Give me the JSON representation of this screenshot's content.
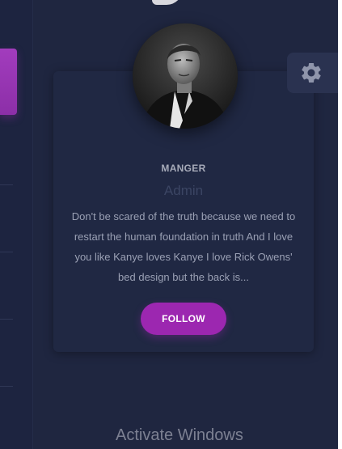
{
  "profile_card": {
    "role": "MANGER",
    "name": "Admin",
    "description": "Don't be scared of the truth because we need to restart the human foundation in truth And I love you like Kanye loves Kanye I love Rick Owens' bed design but the back is...",
    "follow_label": "FOLLOW"
  },
  "settings": {
    "icon": "gear-icon"
  },
  "watermark": {
    "text": "Activate Windows"
  },
  "colors": {
    "background": "#1f2640",
    "card": "#202843",
    "accent": "#9c27b0",
    "muted_text": "#9aa0b4"
  }
}
